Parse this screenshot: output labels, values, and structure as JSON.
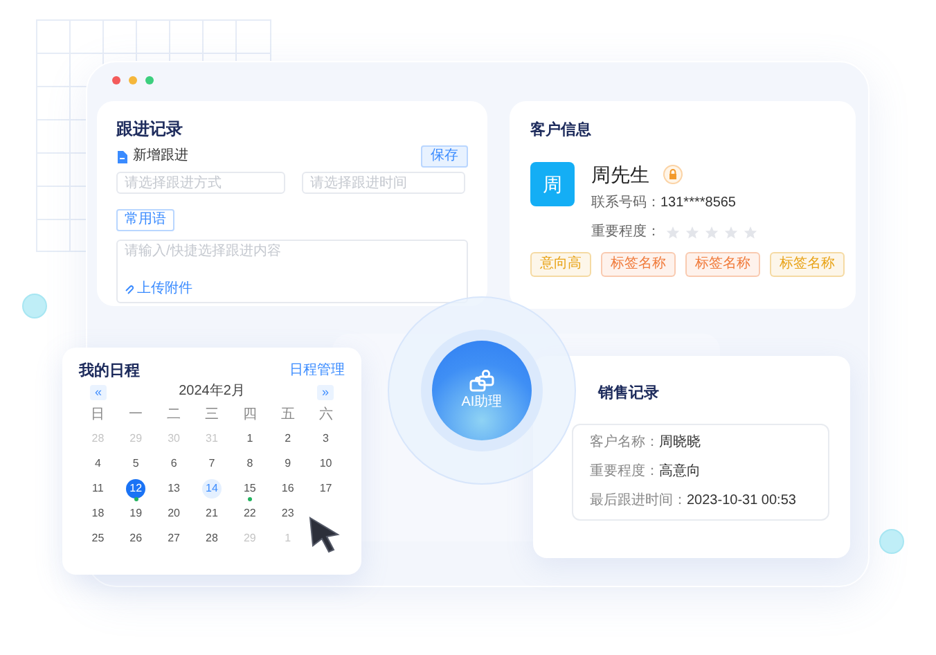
{
  "follow_up": {
    "title": "跟进记录",
    "new_label": "新增跟进",
    "save_button": "保存",
    "method_field": {
      "placeholder": "请选择跟进方式"
    },
    "time_field": {
      "placeholder": "请选择跟进时间"
    },
    "phrases_button": "常用语",
    "content_field": {
      "placeholder": "请输入/快捷选择跟进内容"
    },
    "upload_link": "上传附件"
  },
  "customer": {
    "title": "客户信息",
    "avatar": "周",
    "name": "周先生",
    "phone_label": "联系号码：",
    "phone": "131****8565",
    "importance_label": "重要程度：",
    "stars": 0,
    "tags": [
      {
        "label": "意向高",
        "color": "#e8a317"
      },
      {
        "label": "标签名称",
        "color": "#f07a3a"
      },
      {
        "label": "标签名称",
        "color": "#f07a3a"
      },
      {
        "label": "标签名称",
        "color": "#e8a317"
      }
    ]
  },
  "schedule": {
    "title": "我的日程",
    "manage_link": "日程管理",
    "prev": "«",
    "month": "2024年2月",
    "next": "»",
    "weekdays": [
      "日",
      "一",
      "二",
      "三",
      "四",
      "五",
      "六"
    ],
    "weeks": [
      [
        {
          "day": "28",
          "muted": true
        },
        {
          "day": "29",
          "muted": true
        },
        {
          "day": "30",
          "muted": true
        },
        {
          "day": "31",
          "muted": true
        },
        {
          "day": "1",
          "muted": false
        },
        {
          "day": "2",
          "muted": false
        },
        {
          "day": "3",
          "muted": false
        }
      ],
      [
        {
          "day": "4",
          "muted": false
        },
        {
          "day": "5",
          "muted": false
        },
        {
          "day": "6",
          "muted": false
        },
        {
          "day": "7",
          "muted": false
        },
        {
          "day": "8",
          "muted": false
        },
        {
          "day": "9",
          "muted": false
        },
        {
          "day": "10",
          "muted": false
        }
      ],
      [
        {
          "day": "11",
          "muted": false
        },
        {
          "day": "12",
          "muted": false,
          "selected": true,
          "event": true
        },
        {
          "day": "13",
          "muted": false
        },
        {
          "day": "14",
          "muted": false,
          "today": true
        },
        {
          "day": "15",
          "muted": false,
          "event": true
        },
        {
          "day": "16",
          "muted": false
        },
        {
          "day": "17",
          "muted": false
        }
      ],
      [
        {
          "day": "18",
          "muted": false
        },
        {
          "day": "19",
          "muted": false
        },
        {
          "day": "20",
          "muted": false
        },
        {
          "day": "21",
          "muted": false
        },
        {
          "day": "22",
          "muted": false
        },
        {
          "day": "23",
          "muted": false
        }
      ],
      [
        {
          "day": "25",
          "muted": false
        },
        {
          "day": "26",
          "muted": false
        },
        {
          "day": "27",
          "muted": false
        },
        {
          "day": "28",
          "muted": false
        },
        {
          "day": "29",
          "muted": true
        },
        {
          "day": "1",
          "muted": true
        }
      ]
    ]
  },
  "assistant": {
    "label": "AI助理"
  },
  "sales": {
    "title": "销售记录",
    "rows": [
      {
        "label": "客户名称：",
        "value": "周晓晓"
      },
      {
        "label": "重要程度：",
        "value": "高意向"
      },
      {
        "label": "最后跟进时间：",
        "value": "2023-10-31 00:53"
      }
    ]
  }
}
